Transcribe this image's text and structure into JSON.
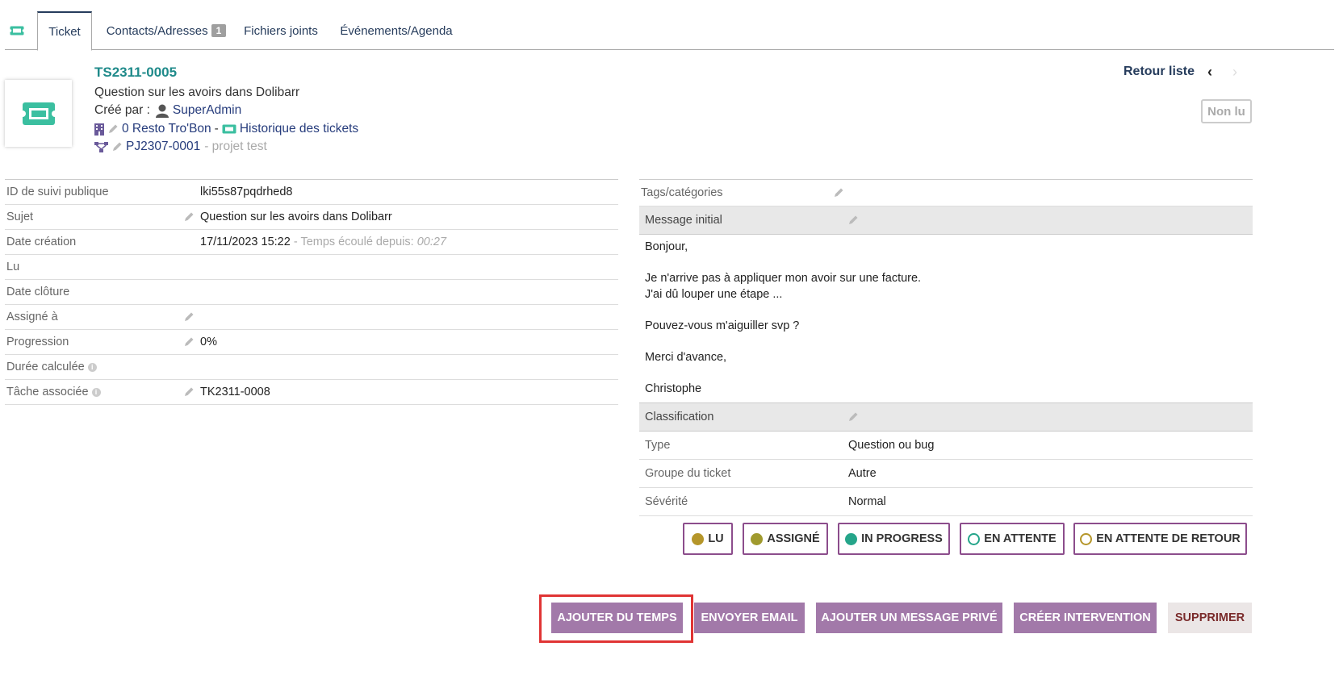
{
  "tabs": {
    "ticket": "Ticket",
    "contacts": "Contacts/Adresses",
    "contacts_count": "1",
    "files": "Fichiers joints",
    "events": "Événements/Agenda"
  },
  "banner": {
    "ref": "TS2311-0005",
    "subject": "Question sur les avoirs dans Dolibarr",
    "created_by_label": "Créé par :",
    "created_by": "SuperAdmin",
    "company": "0 Resto Tro'Bon",
    "separator": "-",
    "history_link": "Historique des tickets",
    "project_ref": "PJ2307-0001",
    "project_name": "- projet test",
    "back_to_list": "Retour liste",
    "prev": "‹",
    "next": "›",
    "unread_badge": "Non lu"
  },
  "fields": {
    "track_id": {
      "label": "ID de suivi publique",
      "value": "lki55s87pqdrhed8"
    },
    "subject": {
      "label": "Sujet",
      "value": "Question sur les avoirs dans Dolibarr"
    },
    "date_creation": {
      "label": "Date création",
      "value": "17/11/2023 15:22",
      "elapsed_label": "- Temps écoulé depuis:",
      "elapsed": "00:27"
    },
    "read": {
      "label": "Lu"
    },
    "date_close": {
      "label": "Date clôture"
    },
    "assigned": {
      "label": "Assigné à"
    },
    "progress": {
      "label": "Progression",
      "value": "0%"
    },
    "duration": {
      "label": "Durée calculée"
    },
    "task": {
      "label": "Tâche associée",
      "value": "TK2311-0008"
    }
  },
  "right": {
    "tags_label": "Tags/catégories",
    "message_label": "Message initial",
    "message_lines": [
      "Bonjour,",
      "",
      "Je n'arrive pas à appliquer mon avoir sur une facture.",
      "J'ai dû louper une étape ...",
      "",
      "Pouvez-vous m'aiguiller svp ?",
      "",
      "Merci d'avance,",
      "",
      "Christophe"
    ],
    "classification_label": "Classification",
    "type": {
      "label": "Type",
      "value": "Question ou bug"
    },
    "group": {
      "label": "Groupe du ticket",
      "value": "Autre"
    },
    "severity": {
      "label": "Sévérité",
      "value": "Normal"
    }
  },
  "status_buttons": {
    "read": "LU",
    "assigned": "ASSIGNÉ",
    "in_progress": "IN PROGRESS",
    "waiting": "EN ATTENTE",
    "waiting_return": "EN ATTENTE DE RETOUR"
  },
  "actions": {
    "add_time": "AJOUTER DU TEMPS",
    "send_email": "ENVOYER EMAIL",
    "add_private": "AJOUTER UN MESSAGE PRIVÉ",
    "create_intervention": "CRÉER INTERVENTION",
    "delete": "SUPPRIMER"
  },
  "colors": {
    "accent": "#1f8a8a",
    "ticket_icon": "#3bbfa0",
    "button": "#a279a9",
    "highlight": "#e03434",
    "status_read": "#b5962a",
    "status_assigned": "#a09a2e",
    "status_progress": "#25a58a"
  }
}
